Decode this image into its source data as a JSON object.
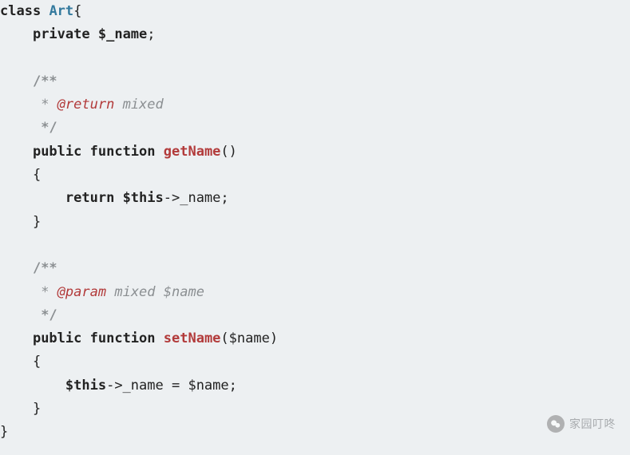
{
  "code": {
    "class_kw": "class",
    "class_name": "Art",
    "brace_open": "{",
    "brace_close": "}",
    "private_kw": "private",
    "name_prop": "$_name",
    "semicolon": ";",
    "doc_open": "/**",
    "doc_star": " *",
    "doc_close": " */",
    "return_tag": "@return",
    "return_type": " mixed",
    "param_tag": "@param",
    "param_rest": " mixed $name",
    "public_kw": "public",
    "function_kw": "function",
    "getName": "getName",
    "setName": "setName",
    "parens_empty": "()",
    "parens_open": "(",
    "parens_close": ")",
    "param_name": "$name",
    "return_kw": "return",
    "this_kw": "$this",
    "arrow_name_semi": "->_name;",
    "assign_eq": " = ",
    "arrow_name": "->_name"
  },
  "watermark": {
    "text": "家园叮咚"
  }
}
